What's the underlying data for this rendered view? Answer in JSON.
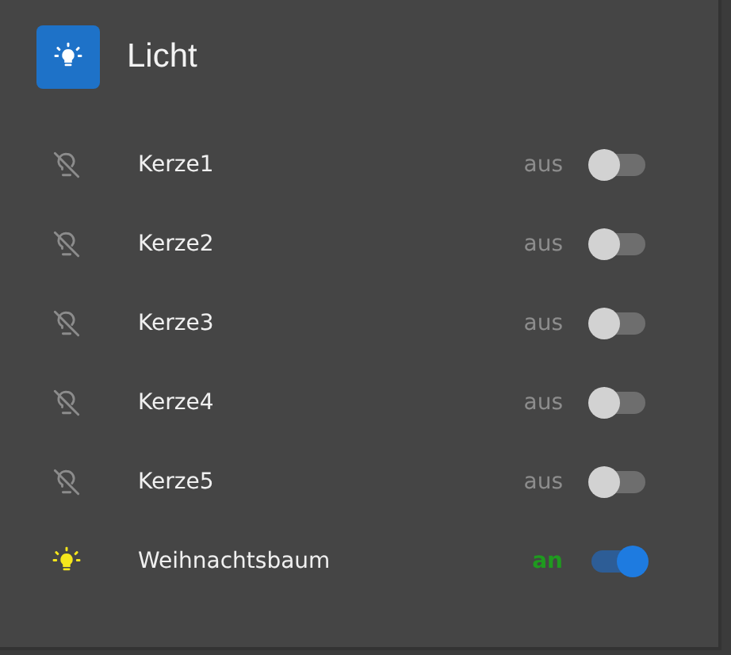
{
  "header": {
    "title": "Licht"
  },
  "lights": [
    {
      "name": "Kerze1",
      "state": "aus",
      "on": false
    },
    {
      "name": "Kerze2",
      "state": "aus",
      "on": false
    },
    {
      "name": "Kerze3",
      "state": "aus",
      "on": false
    },
    {
      "name": "Kerze4",
      "state": "aus",
      "on": false
    },
    {
      "name": "Kerze5",
      "state": "aus",
      "on": false
    },
    {
      "name": "Weihnachtsbaum",
      "state": "an",
      "on": true
    }
  ]
}
